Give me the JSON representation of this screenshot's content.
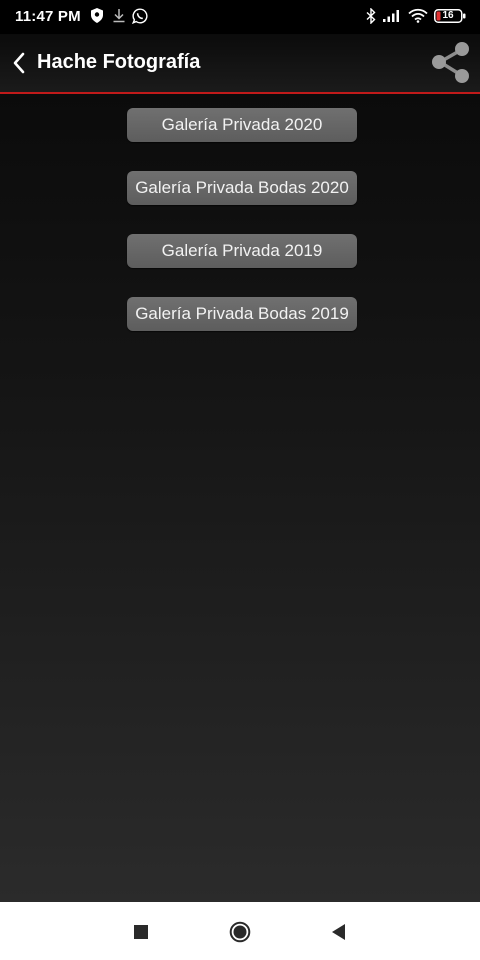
{
  "status_bar": {
    "time": "11:47 PM",
    "battery_level": "16",
    "icons": [
      "vpn-shield-icon",
      "download-icon",
      "whatsapp-icon",
      "bluetooth-icon",
      "signal-icon",
      "wifi-icon",
      "battery-icon"
    ]
  },
  "app_bar": {
    "title": "Hache Fotografía",
    "back_icon": "chevron-left-icon",
    "share_icon": "share-icon"
  },
  "galleries": [
    {
      "label": "Galería Privada 2020"
    },
    {
      "label": "Galería Privada Bodas 2020"
    },
    {
      "label": "Galería Privada 2019"
    },
    {
      "label": "Galería Privada Bodas 2019"
    }
  ],
  "nav_bar": {
    "icons": [
      "recents-square-icon",
      "home-circle-icon",
      "back-triangle-icon"
    ]
  },
  "colors": {
    "accent": "#c01a1a",
    "button": "#666666",
    "nav_background": "#ffffff"
  }
}
